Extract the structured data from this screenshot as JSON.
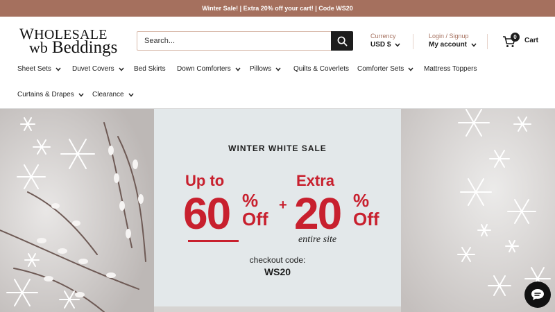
{
  "announcement": {
    "text": "Winter Sale! | Extra 20% off your cart! | Code WS20"
  },
  "logo": {
    "line1_cap": "W",
    "line1_rest": "HOLESALE",
    "line2_wb": "wb",
    "line2_rest": "Beddings"
  },
  "search": {
    "placeholder": "Search..."
  },
  "currency": {
    "label": "Currency",
    "value": "USD $"
  },
  "account": {
    "label": "Login / Signup",
    "value": "My account"
  },
  "cart": {
    "count": "0",
    "label": "Cart"
  },
  "nav": [
    {
      "label": "Sheet Sets",
      "has_dropdown": true
    },
    {
      "label": "Duvet Covers",
      "has_dropdown": true
    },
    {
      "label": "Bed Skirts",
      "has_dropdown": false
    },
    {
      "label": "Down Comforters",
      "has_dropdown": true
    },
    {
      "label": "Pillows",
      "has_dropdown": true
    },
    {
      "label": "Quilts & Coverlets",
      "has_dropdown": false
    },
    {
      "label": "Comforter Sets",
      "has_dropdown": true
    },
    {
      "label": "Mattress Toppers",
      "has_dropdown": false
    },
    {
      "label": "Curtains & Drapes",
      "has_dropdown": true
    },
    {
      "label": "Clearance",
      "has_dropdown": true
    }
  ],
  "hero": {
    "title": "WINTER WHITE SALE",
    "left_prefix": "Up to",
    "left_number": "60",
    "left_percent": "%",
    "left_off": "Off",
    "plus": "+",
    "right_prefix": "Extra",
    "right_number": "20",
    "right_percent": "%",
    "right_off": "Off",
    "right_sub": "entire site",
    "checkout_label": "checkout code:",
    "code": "WS20"
  },
  "colors": {
    "brand": "#a5705e",
    "accent_red": "#c8202e",
    "dark": "#1d1d1d"
  },
  "icons": {
    "search": "search-icon",
    "cart": "cart-icon",
    "chat": "chat-icon",
    "chevron": "chevron-down-icon"
  }
}
